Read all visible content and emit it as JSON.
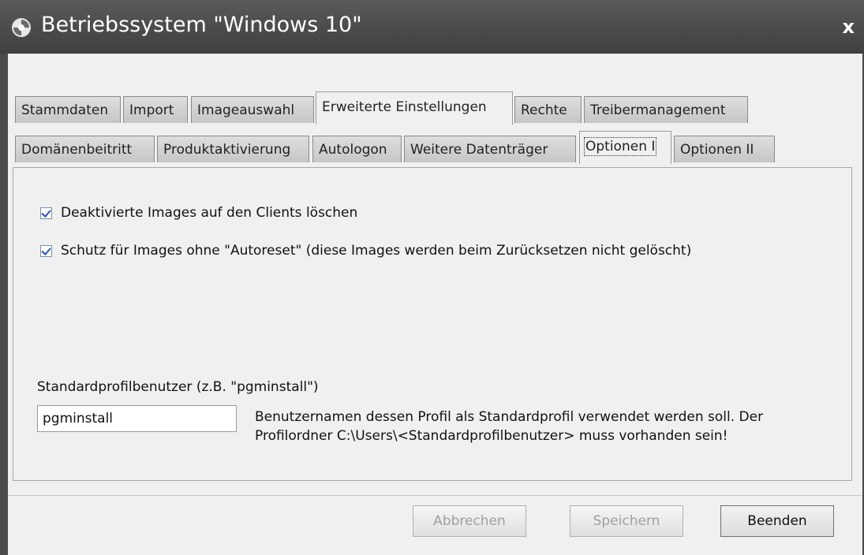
{
  "window": {
    "title": "Betriebssystem \"Windows 10\"",
    "close": "x"
  },
  "tabs_main": [
    {
      "label": "Stammdaten"
    },
    {
      "label": "Import"
    },
    {
      "label": "Imageauswahl"
    },
    {
      "label": "Erweiterte Einstellungen",
      "active": true
    },
    {
      "label": "Rechte"
    },
    {
      "label": "Treibermanagement"
    }
  ],
  "tabs_sub": [
    {
      "label": "Domänenbeitritt"
    },
    {
      "label": "Produktaktivierung"
    },
    {
      "label": "Autologon"
    },
    {
      "label": "Weitere Datenträger"
    },
    {
      "label": "Optionen I",
      "active": true
    },
    {
      "label": "Optionen II"
    }
  ],
  "options": {
    "checkbox1": {
      "label": "Deaktivierte Images auf den Clients löschen",
      "checked": true
    },
    "checkbox2": {
      "label": "Schutz für Images ohne \"Autoreset\" (diese Images werden beim Zurücksetzen nicht gelöscht)",
      "checked": true
    },
    "profile_label": "Standardprofilbenutzer (z.B. \"pgminstall\")",
    "profile_value": "pgminstall",
    "profile_hint_line1": "Benutzernamen dessen Profil als Standardprofil verwendet werden soll. Der",
    "profile_hint_line2": "Profilordner C:\\Users\\<Standardprofilbenutzer> muss vorhanden sein!"
  },
  "buttons": {
    "cancel": "Abbrechen",
    "save": "Speichern",
    "quit": "Beenden"
  },
  "colors": {
    "titlebar": "#4a4a4a",
    "check": "#2a55b8"
  }
}
